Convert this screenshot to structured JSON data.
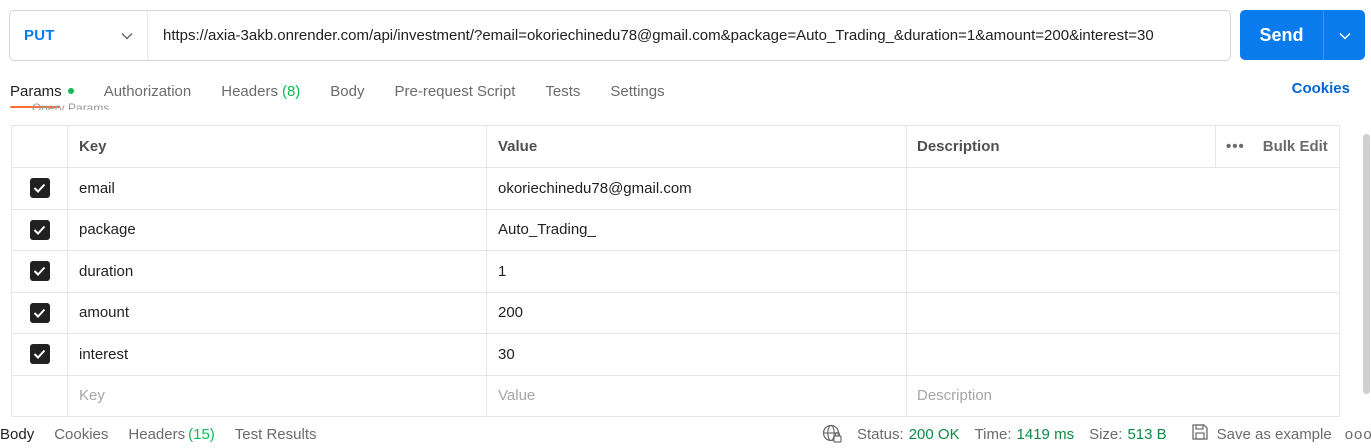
{
  "request": {
    "method": "PUT",
    "url": "https://axia-3akb.onrender.com/api/investment/?email=okoriechinedu78@gmail.com&package=Auto_Trading_&duration=1&amount=200&interest=30",
    "send_label": "Send"
  },
  "tabs": [
    {
      "label": "Params",
      "active": true
    },
    {
      "label": "Authorization"
    },
    {
      "label": "Headers",
      "count": "(8)"
    },
    {
      "label": "Body"
    },
    {
      "label": "Pre-request Script"
    },
    {
      "label": "Tests"
    },
    {
      "label": "Settings"
    }
  ],
  "cookies_label": "Cookies",
  "section_title": "Query Params",
  "table": {
    "headers": {
      "key": "Key",
      "value": "Value",
      "description": "Description",
      "bulk_edit": "Bulk Edit"
    },
    "rows": [
      {
        "key": "email",
        "value": "okoriechinedu78@gmail.com",
        "checked": true
      },
      {
        "key": "package",
        "value": "Auto_Trading_",
        "checked": true
      },
      {
        "key": "duration",
        "value": "1",
        "checked": true
      },
      {
        "key": "amount",
        "value": "200",
        "checked": true
      },
      {
        "key": "interest",
        "value": "30",
        "checked": true
      }
    ],
    "placeholders": {
      "key": "Key",
      "value": "Value",
      "description": "Description"
    }
  },
  "response": {
    "tabs": [
      {
        "label": "Body",
        "active": true
      },
      {
        "label": "Cookies"
      },
      {
        "label": "Headers",
        "count": "(15)"
      },
      {
        "label": "Test Results"
      }
    ],
    "status_label": "Status:",
    "status_value": "200 OK",
    "time_label": "Time:",
    "time_value": "1419 ms",
    "size_label": "Size:",
    "size_value": "513 B",
    "save_label": "Save as example",
    "more": "ooo"
  },
  "colors": {
    "accent": "#097bed",
    "success": "#0cbb52",
    "tab_indicator": "#ff6c37",
    "link": "#0265d2"
  }
}
